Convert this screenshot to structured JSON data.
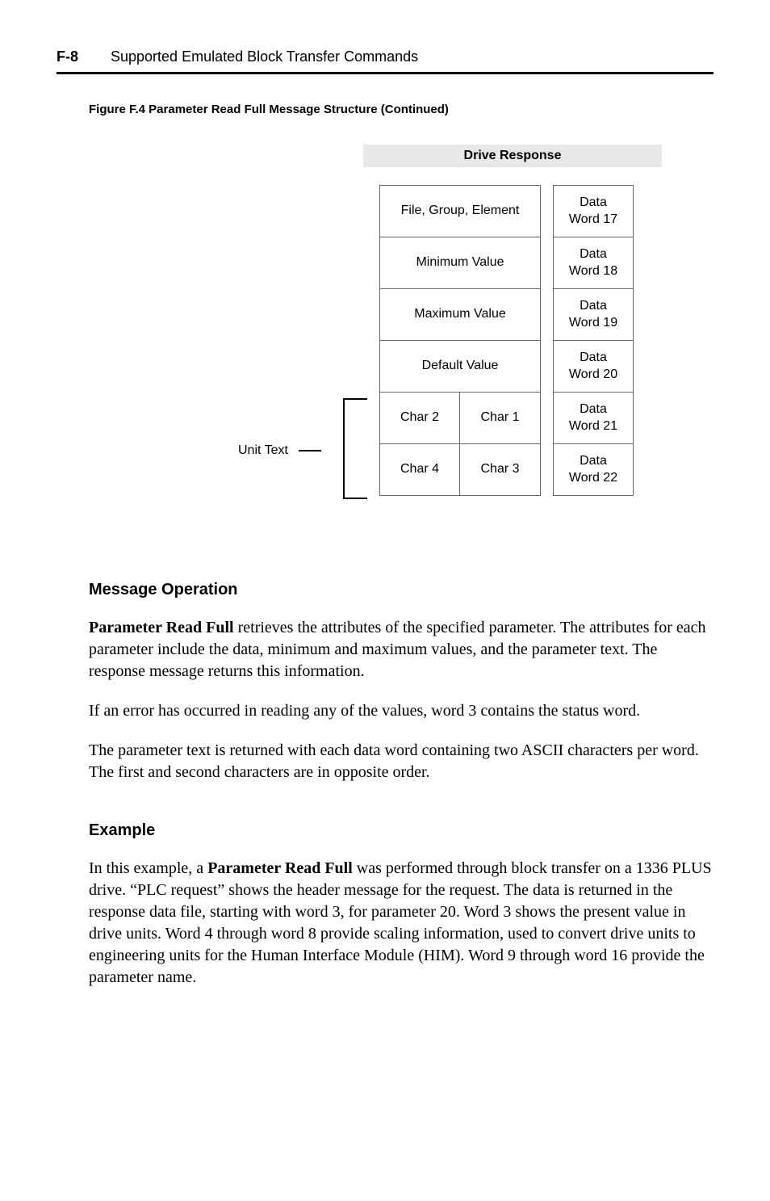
{
  "header": {
    "pageNumber": "F-8",
    "title": "Supported Emulated Block Transfer Commands"
  },
  "figure": {
    "caption": "Figure F.4  Parameter Read Full Message Structure (Continued)",
    "responseHeader": "Drive Response",
    "unitTextLabel": "Unit Text",
    "leftCells": [
      {
        "type": "single",
        "text": "File, Group, Element"
      },
      {
        "type": "single",
        "text": "Minimum Value"
      },
      {
        "type": "single",
        "text": "Maximum Value"
      },
      {
        "type": "single",
        "text": "Default Value"
      },
      {
        "type": "split",
        "left": "Char 2",
        "right": "Char 1"
      },
      {
        "type": "split",
        "left": "Char 4",
        "right": "Char 3"
      }
    ],
    "rightCells": [
      "Data\nWord 17",
      "Data\nWord 18",
      "Data\nWord 19",
      "Data\nWord 20",
      "Data\nWord 21",
      "Data\nWord 22"
    ]
  },
  "sections": {
    "messageOperation": {
      "heading": "Message Operation",
      "para1_bold": "Parameter Read Full",
      "para1_rest": " retrieves the attributes of the specified parameter. The attributes for each parameter include the data, minimum and maximum values, and the parameter text. The response message returns this information.",
      "para2": "If an error has occurred in reading any of the values, word 3 contains the status word.",
      "para3": "The parameter text is returned with each data word containing two ASCII characters per word. The first and second characters are in opposite order."
    },
    "example": {
      "heading": "Example",
      "para1_pre": "In this example, a ",
      "para1_bold": "Parameter Read Full",
      "para1_post": " was performed through block transfer on a 1336 PLUS drive. “PLC request” shows the header message for the request. The data is returned in the response data file, starting with word 3, for parameter 20. Word 3 shows the present value in drive units. Word 4 through word 8 provide scaling information, used to convert drive units to engineering units for the Human Interface Module (HIM). Word 9 through word 16 provide the parameter name."
    }
  }
}
